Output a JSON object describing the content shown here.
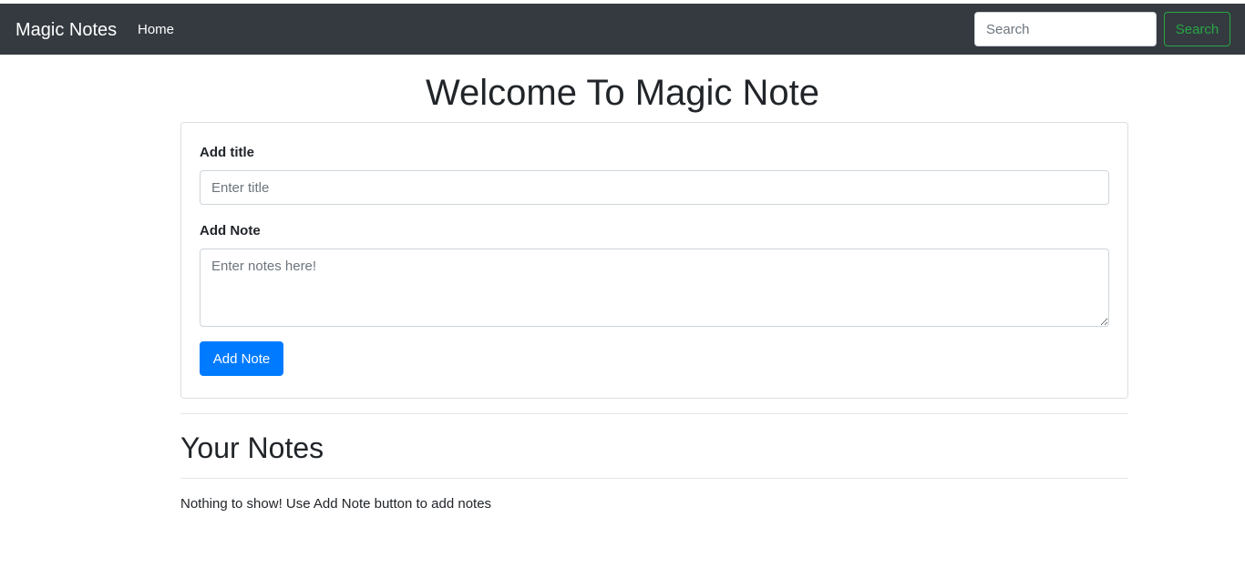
{
  "navbar": {
    "brand": "Magic Notes",
    "links": [
      {
        "label": "Home"
      }
    ],
    "search": {
      "placeholder": "Search",
      "value": "",
      "button_label": "Search"
    }
  },
  "main": {
    "heading": "Welcome To Magic Note",
    "form": {
      "title_label": "Add title",
      "title_placeholder": "Enter title",
      "title_value": "",
      "note_label": "Add Note",
      "note_placeholder": "Enter notes here!",
      "note_value": "",
      "submit_label": "Add Note"
    },
    "notes_section": {
      "heading": "Your Notes",
      "empty_message": "Nothing to show! Use Add Note button to add notes"
    }
  },
  "colors": {
    "navbar_bg": "#343a40",
    "primary": "#007bff",
    "success": "#28a745"
  }
}
